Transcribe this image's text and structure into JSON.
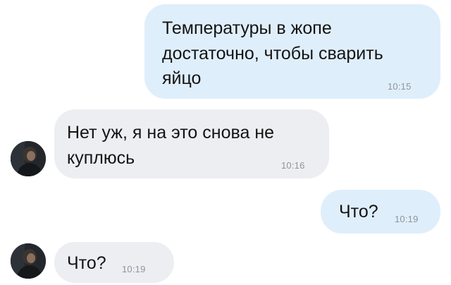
{
  "messages": [
    {
      "direction": "outgoing",
      "lines": [
        "Температуры в жопе",
        "достаточно, чтобы сварить",
        "яйцо"
      ],
      "time": "10:15"
    },
    {
      "direction": "incoming",
      "lines": [
        "Нет уж, я на это снова не",
        "куплюсь"
      ],
      "time": "10:16",
      "avatar": "user-avatar"
    },
    {
      "direction": "outgoing",
      "lines": [
        "Что?"
      ],
      "time": "10:19"
    },
    {
      "direction": "incoming",
      "lines": [
        "Что?"
      ],
      "time": "10:19",
      "avatar": "user-avatar"
    }
  ],
  "colors": {
    "outgoing_bubble": "#dfeefb",
    "incoming_bubble": "#eceef2",
    "text": "#141414",
    "timestamp": "#8f959c"
  }
}
